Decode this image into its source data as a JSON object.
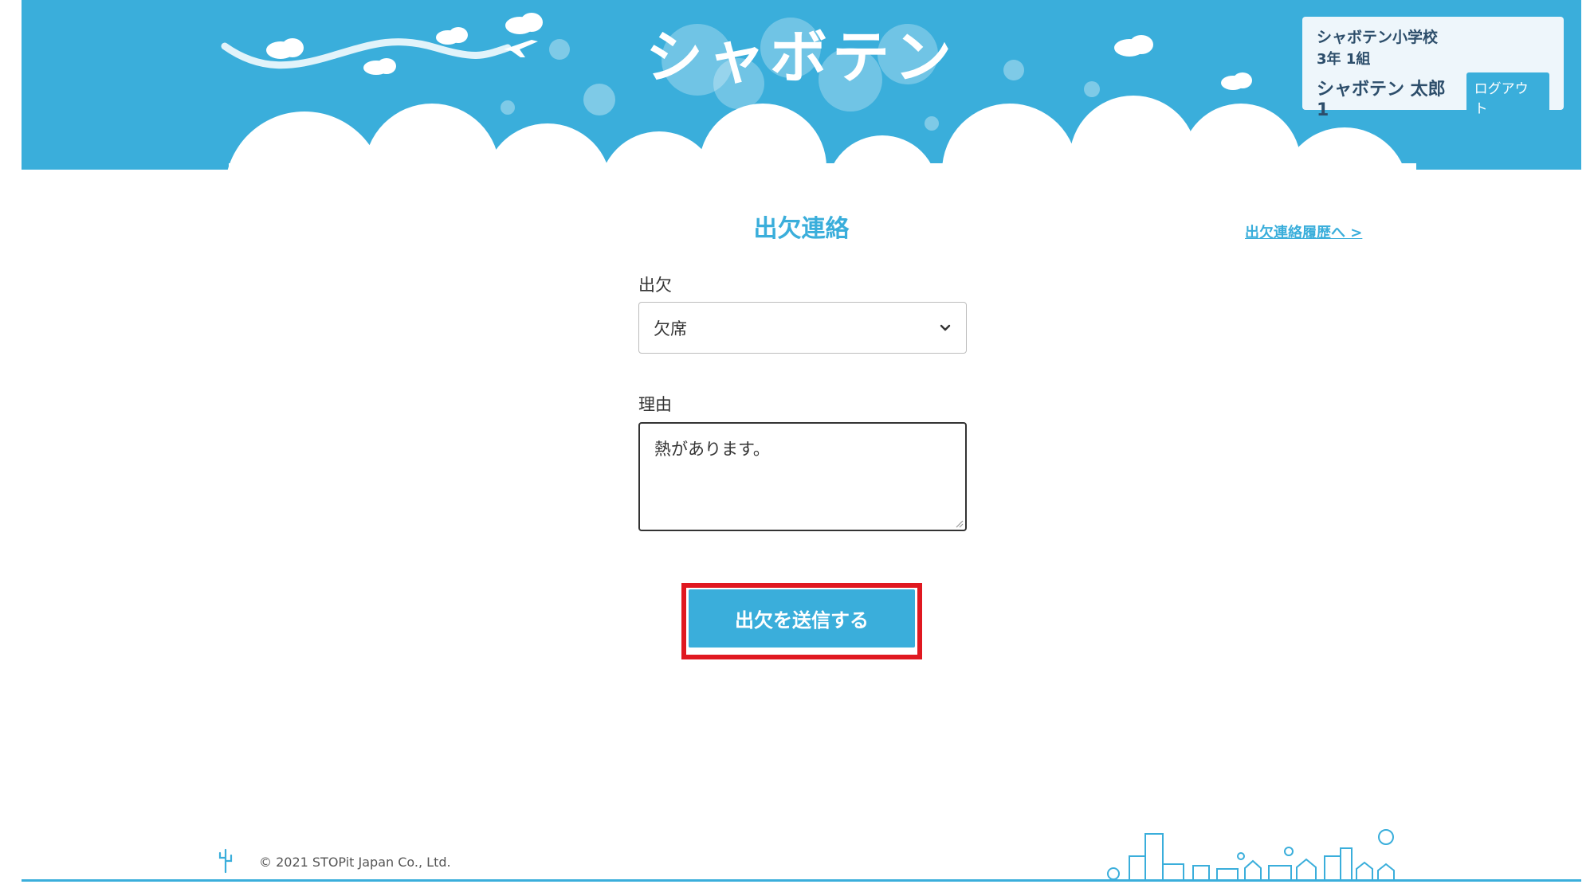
{
  "header": {
    "logo_text": "シャボテン",
    "user": {
      "school": "シャボテン小学校",
      "grade_class": "3年 1組",
      "name": "シャボテン 太郎1",
      "logout_label": "ログアウト"
    }
  },
  "main": {
    "title": "出欠連絡",
    "history_link": "出欠連絡履歴へ >",
    "attendance": {
      "label": "出欠",
      "selected": "欠席"
    },
    "reason": {
      "label": "理由",
      "value": "熱があります。"
    },
    "submit_label": "出欠を送信する"
  },
  "footer": {
    "copyright": "© 2021 STOPit Japan Co., Ltd."
  },
  "colors": {
    "accent": "#3aaedb",
    "highlight": "#e01820"
  },
  "icons": [
    "airplane-icon",
    "cloud-icon",
    "bubble-icon",
    "chevron-down-icon",
    "cactus-icon",
    "cityscape-icon"
  ]
}
